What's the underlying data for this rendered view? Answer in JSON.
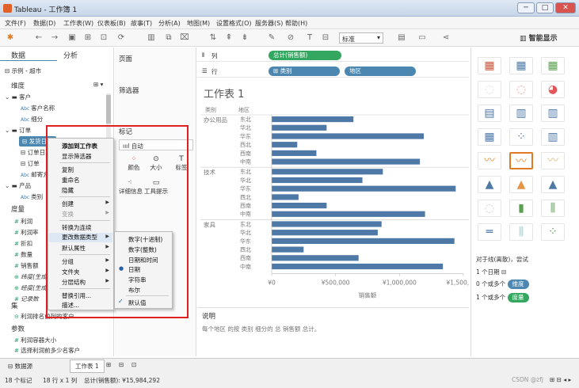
{
  "window": {
    "title": "Tableau - 工作簿 1",
    "minimize": "─",
    "maximize": "□",
    "close": "✕"
  },
  "menu": [
    "文件(F)",
    "数据(D)",
    "工作表(W)",
    "仪表板(B)",
    "故事(T)",
    "分析(A)",
    "地图(M)",
    "设置格式(O)",
    "服务器(S)",
    "帮助(H)"
  ],
  "toolbar": {
    "standard": "标准",
    "smart": "智能显示"
  },
  "left": {
    "tabs": [
      "数据",
      "分析"
    ],
    "datasource": "示例 - 超市",
    "dimensions_header": "维度",
    "dims": [
      "客户",
      "客户名称",
      "细分",
      "订单",
      "发货日期",
      "订单日期",
      "订单",
      "邮寄方式",
      "产品",
      "类别"
    ],
    "measures_header": "度量",
    "measures": [
      "利润",
      "利润率",
      "折扣",
      "数量",
      "销售额",
      "纬度(生成)",
      "经度(生成)",
      "记录数"
    ],
    "sets_header": "集",
    "sets": [
      "利润排名前列的客户"
    ],
    "params_header": "参数",
    "params": [
      "利润容器大小",
      "选择利润前多少名客户"
    ]
  },
  "shelves": {
    "pages": "页面",
    "filters": "筛选器",
    "marks": "标记",
    "mark_type": "自动",
    "mark_btns": [
      "颜色",
      "大小",
      "标签",
      "详细信息",
      "工具提示"
    ],
    "columns": "列",
    "rows": "行"
  },
  "pills": {
    "col": "总计(销售额)",
    "row1": "类别",
    "row2": "地区"
  },
  "chart_data": {
    "type": "bar",
    "title": "工作表 1",
    "headers": [
      "类别",
      "地区"
    ],
    "categories": [
      "办公用品",
      "技术",
      "家具"
    ],
    "regions": [
      "东北",
      "华北",
      "华东",
      "西北",
      "西南",
      "中南"
    ],
    "values": [
      [
        640000,
        430000,
        1190000,
        200000,
        350000,
        1160000
      ],
      [
        870000,
        710000,
        1440000,
        210000,
        430000,
        1200000
      ],
      [
        860000,
        830000,
        1430000,
        250000,
        680000,
        1340000
      ]
    ],
    "xticks": [
      "¥0",
      "¥500,000",
      "¥1,000,000",
      "¥1,500,000"
    ],
    "xlabel": "销售额",
    "xlim": [
      0,
      1500000
    ],
    "color": "#4e79a7"
  },
  "description": {
    "header": "说明",
    "text": "每个地区 的按 类别 细分的 总 销售额 总计。"
  },
  "smartshow": {
    "hint": "对于线(离散)，尝试",
    "req1": "1 个日期",
    "req2_prefix": "0 个或多个",
    "req2_pill": "维度",
    "req3_prefix": "1 个或多个",
    "req3_pill": "度量"
  },
  "context_menu": {
    "items": [
      "添加到工作表",
      "显示筛选器",
      "复制",
      "重命名",
      "隐藏",
      "创建",
      "变换",
      "转换为连续",
      "更改数据类型",
      "默认属性",
      "分组",
      "文件夹",
      "分层结构",
      "替换引用...",
      "描述..."
    ],
    "submenu": [
      "数字(十进制)",
      "数字(整数)",
      "日期和时间",
      "日期",
      "字符串",
      "布尔",
      "默认值"
    ]
  },
  "status": {
    "tabs": [
      "数据源",
      "工作表 1"
    ],
    "marks": "18 个标记",
    "rows": "18 行 x 1 列",
    "sum": "总计(销售额): ¥15,984,292",
    "watermark": "CSDN @zfj"
  }
}
